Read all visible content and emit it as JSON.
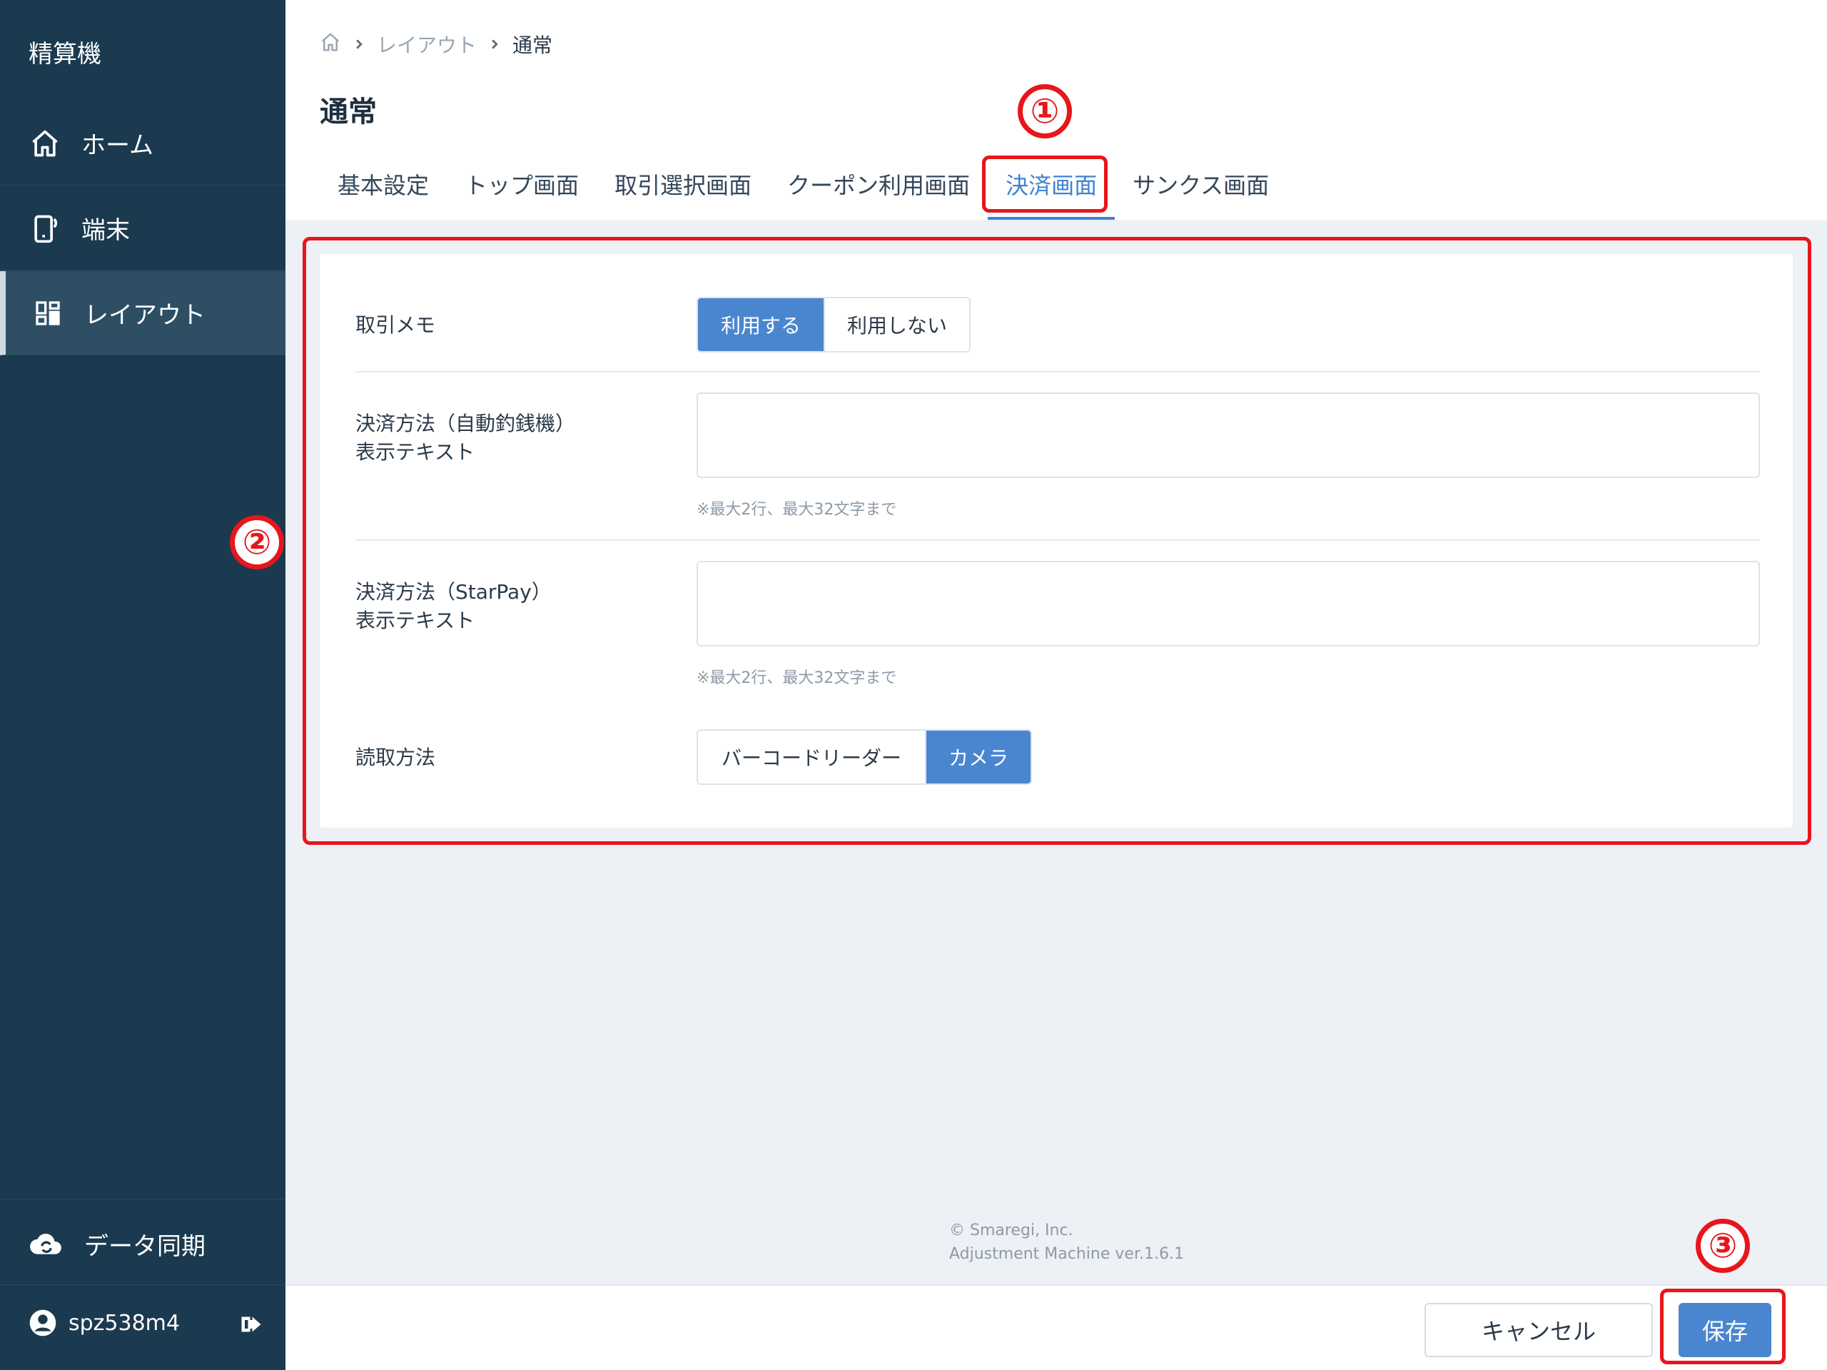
{
  "sidebar": {
    "app_title": "精算機",
    "items": [
      {
        "label": "ホーム",
        "icon": "home-icon"
      },
      {
        "label": "端末",
        "icon": "device-icon"
      },
      {
        "label": "レイアウト",
        "icon": "layout-grid-icon",
        "active": true
      }
    ],
    "sync_label": "データ同期",
    "username": "spz538m4"
  },
  "breadcrumb": {
    "level1": "レイアウト",
    "current": "通常"
  },
  "page_title": "通常",
  "tabs": [
    {
      "label": "基本設定"
    },
    {
      "label": "トップ画面"
    },
    {
      "label": "取引選択画面"
    },
    {
      "label": "クーポン利用画面"
    },
    {
      "label": "決済画面",
      "active": true
    },
    {
      "label": "サンクス画面"
    }
  ],
  "form": {
    "memo": {
      "label": "取引メモ",
      "options": [
        "利用する",
        "利用しない"
      ],
      "selected": "利用する"
    },
    "auto_changer": {
      "label_line1": "決済方法（自動釣銭機）",
      "label_line2": "表示テキスト",
      "value": "",
      "hint": "※最大2行、最大32文字まで"
    },
    "starpay": {
      "label_line1": "決済方法（StarPay）",
      "label_line2": "表示テキスト",
      "value": "",
      "hint": "※最大2行、最大32文字まで"
    },
    "read_method": {
      "label": "読取方法",
      "options": [
        "バーコードリーダー",
        "カメラ"
      ],
      "selected": "カメラ"
    }
  },
  "footer": {
    "copyright": "© Smaregi, Inc.",
    "version": "Adjustment Machine ver.1.6.1"
  },
  "actions": {
    "cancel_label": "キャンセル",
    "save_label": "保存"
  },
  "annotations": {
    "num1": "①",
    "num2": "②",
    "num3": "③"
  },
  "colors": {
    "sidebar_bg": "#1b3a50",
    "accent": "#4a86d0",
    "annotation_red": "#e8151c"
  }
}
